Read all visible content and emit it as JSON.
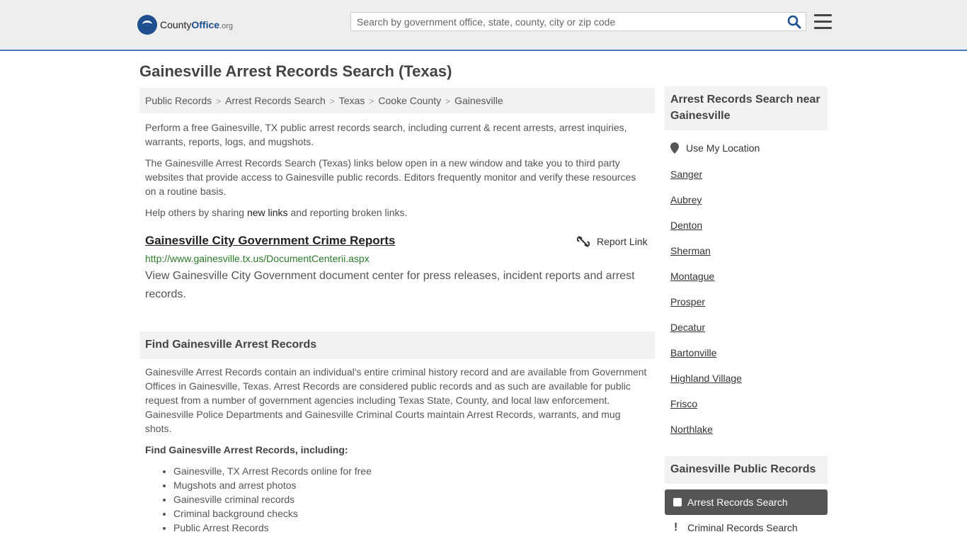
{
  "header": {
    "logo": {
      "county": "County",
      "office": "Office",
      "org": ".org"
    },
    "search_placeholder": "Search by government office, state, county, city or zip code"
  },
  "page_title": "Gainesville Arrest Records Search (Texas)",
  "breadcrumb": [
    "Public Records",
    "Arrest Records Search",
    "Texas",
    "Cooke County",
    "Gainesville"
  ],
  "intro": {
    "p1": "Perform a free Gainesville, TX public arrest records search, including current & recent arrests, arrest inquiries, warrants, reports, logs, and mugshots.",
    "p2": "The Gainesville Arrest Records Search (Texas) links below open in a new window and take you to third party websites that provide access to Gainesville public records. Editors frequently monitor and verify these resources on a routine basis.",
    "p3_before": "Help others by sharing ",
    "p3_link": "new links",
    "p3_after": " and reporting broken links."
  },
  "listing": {
    "title": "Gainesville City Government Crime Reports",
    "report_label": "Report Link",
    "url": "http://www.gainesville.tx.us/DocumentCenterii.aspx",
    "description": "View Gainesville City Government document center for press releases, incident reports and arrest records."
  },
  "find_section": {
    "heading": "Find Gainesville Arrest Records",
    "body": "Gainesville Arrest Records contain an individual's entire criminal history record and are available from Government Offices in Gainesville, Texas. Arrest Records are considered public records and as such are available for public request from a number of government agencies including Texas State, County, and local law enforcement. Gainesville Police Departments and Gainesville Criminal Courts maintain Arrest Records, warrants, and mug shots.",
    "list_heading": "Find Gainesville Arrest Records, including:",
    "items": [
      "Gainesville, TX Arrest Records online for free",
      "Mugshots and arrest photos",
      "Gainesville criminal records",
      "Criminal background checks",
      "Public Arrest Records"
    ]
  },
  "sidebar": {
    "near_heading": "Arrest Records Search near Gainesville",
    "use_location": "Use My Location",
    "cities": [
      "Sanger",
      "Aubrey",
      "Denton",
      "Sherman",
      "Montague",
      "Prosper",
      "Decatur",
      "Bartonville",
      "Highland Village",
      "Frisco",
      "Northlake"
    ],
    "public_heading": "Gainesville Public Records",
    "active_link": "Arrest Records Search",
    "next_link": "Criminal Records Search"
  }
}
